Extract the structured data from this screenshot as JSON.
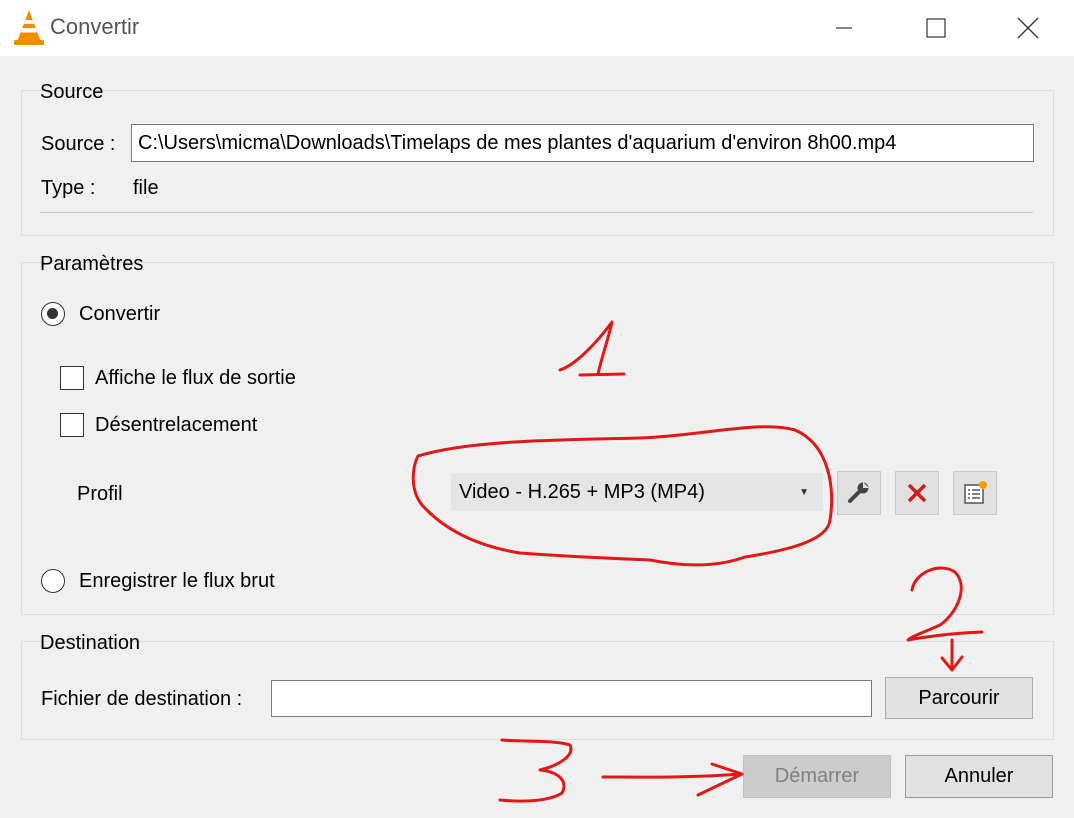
{
  "window": {
    "title": "Convertir",
    "icon": "vlc-cone-icon",
    "controls": [
      "minimize-icon",
      "maximize-icon",
      "close-icon"
    ]
  },
  "source_group": {
    "title": "Source",
    "source_label": "Source :",
    "source_value": "C:\\Users\\micma\\Downloads\\Timelaps de mes plantes d'aquarium d'environ 8h00.mp4",
    "type_label": "Type :",
    "type_value": "file"
  },
  "settings_group": {
    "title": "Paramètres",
    "convert_radio": {
      "label": "Convertir",
      "checked": true
    },
    "show_output_checkbox": {
      "label": "Affiche le flux de sortie",
      "checked": false
    },
    "deinterlace_checkbox": {
      "label": "Désentrelacement",
      "checked": false
    },
    "profile_label": "Profil",
    "profile_selected": "Video - H.265 + MP3 (MP4)",
    "profile_tools": [
      "wrench-icon",
      "delete-x-icon",
      "new-profile-icon"
    ],
    "raw_radio": {
      "label": "Enregistrer le flux brut",
      "checked": false
    }
  },
  "destination_group": {
    "title": "Destination",
    "file_label": "Fichier de destination :",
    "file_value": "",
    "browse_button": "Parcourir"
  },
  "footer": {
    "start_button": "Démarrer",
    "start_enabled": false,
    "cancel_button": "Annuler"
  },
  "colors": {
    "annotation_red": "#e01818",
    "delete_red": "#d41a1a",
    "window_bg": "#f0f0f0"
  },
  "annotations": [
    "1",
    "2",
    "3"
  ]
}
